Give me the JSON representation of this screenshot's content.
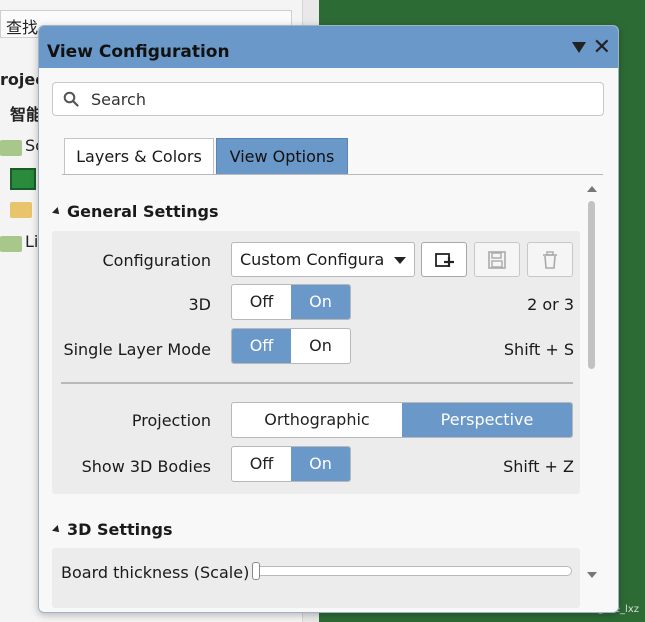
{
  "background": {
    "search_label": "查找",
    "project_label": "roject",
    "tree_item_1": "智能",
    "tree_item_sc": "Sc",
    "tree_item_li": "Li",
    "watermark": "CSDN @ice_lxz"
  },
  "panel": {
    "title": "View Configuration",
    "search_placeholder": "Search",
    "tabs": [
      {
        "label": "Layers & Colors",
        "active": false
      },
      {
        "label": "View Options",
        "active": true
      }
    ],
    "general_settings": {
      "heading": "General Settings",
      "configuration": {
        "label": "Configuration",
        "value": "Custom Configura"
      },
      "three_d": {
        "label": "3D",
        "off": "Off",
        "on": "On",
        "selected": "On",
        "shortcut": "2 or 3"
      },
      "single_layer_mode": {
        "label": "Single Layer Mode",
        "off": "Off",
        "on": "On",
        "selected": "Off",
        "shortcut": "Shift + S"
      },
      "projection": {
        "label": "Projection",
        "orthographic": "Orthographic",
        "perspective": "Perspective",
        "selected": "Perspective"
      },
      "show_3d_bodies": {
        "label": "Show 3D Bodies",
        "off": "Off",
        "on": "On",
        "selected": "On",
        "shortcut": "Shift + Z"
      }
    },
    "three_d_settings": {
      "heading": "3D Settings",
      "board_thickness": {
        "label": "Board thickness (Scale)",
        "value_fraction": 0.0
      }
    }
  },
  "colors": {
    "accent": "#6a98c8",
    "workspace_green": "#2d6b35"
  }
}
